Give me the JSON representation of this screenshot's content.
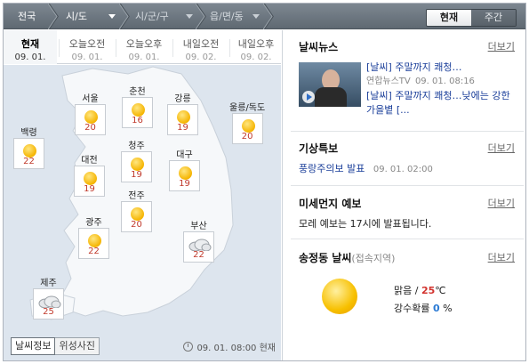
{
  "topbar": {
    "crumbs": [
      "전국",
      "시/도",
      "시/군/구",
      "읍/면/동"
    ],
    "tab_now": "현재",
    "tab_week": "주간"
  },
  "times": [
    {
      "label": "현재",
      "date": "09. 01."
    },
    {
      "label": "오늘오전",
      "date": "09. 01."
    },
    {
      "label": "오늘오후",
      "date": "09. 01."
    },
    {
      "label": "내일오전",
      "date": "09. 02."
    },
    {
      "label": "내일오후",
      "date": "09. 02."
    }
  ],
  "cities": [
    {
      "name": "서울",
      "temp": "20",
      "icon": "sun-icon"
    },
    {
      "name": "춘천",
      "temp": "16",
      "icon": "sun-icon"
    },
    {
      "name": "강릉",
      "temp": "19",
      "icon": "sun-icon"
    },
    {
      "name": "울릉/독도",
      "temp": "20",
      "icon": "sun-icon"
    },
    {
      "name": "백령",
      "temp": "22",
      "icon": "sun-icon"
    },
    {
      "name": "청주",
      "temp": "19",
      "icon": "sun-icon"
    },
    {
      "name": "대전",
      "temp": "19",
      "icon": "sun-icon"
    },
    {
      "name": "대구",
      "temp": "19",
      "icon": "sun-icon"
    },
    {
      "name": "전주",
      "temp": "20",
      "icon": "sun-icon"
    },
    {
      "name": "광주",
      "temp": "22",
      "icon": "sun-icon"
    },
    {
      "name": "부산",
      "temp": "22",
      "icon": "cloud-icon"
    },
    {
      "name": "제주",
      "temp": "25",
      "icon": "cloud-icon"
    }
  ],
  "map_buttons": {
    "weather_info": "날씨정보",
    "satellite": "위성사진"
  },
  "map_time": "09. 01.  08:00 현재",
  "news": {
    "title": "날씨뉴스",
    "more": "더보기",
    "headline1": "[날씨] 주말까지 쾌청…",
    "source": "연합뉴스TV",
    "time": "09. 01.  08:16",
    "headline2": "[날씨] 주말까지 쾌청…낮에는 강한 가을볕 [..."
  },
  "special": {
    "title": "기상특보",
    "more": "더보기",
    "text": "풍랑주의보 발표",
    "time": "09. 01.  02:00"
  },
  "dust": {
    "title": "미세먼지 예보",
    "more": "더보기",
    "text": "모레 예보는 17시에 발표됩니다."
  },
  "local": {
    "title": "송정동 날씨",
    "sub": "(접속지역)",
    "more": "더보기",
    "cond": "맑음 /",
    "temp": "25",
    "unit": "℃",
    "rain_label": "강수확률",
    "rain_value": "0",
    "rain_unit": "%"
  }
}
